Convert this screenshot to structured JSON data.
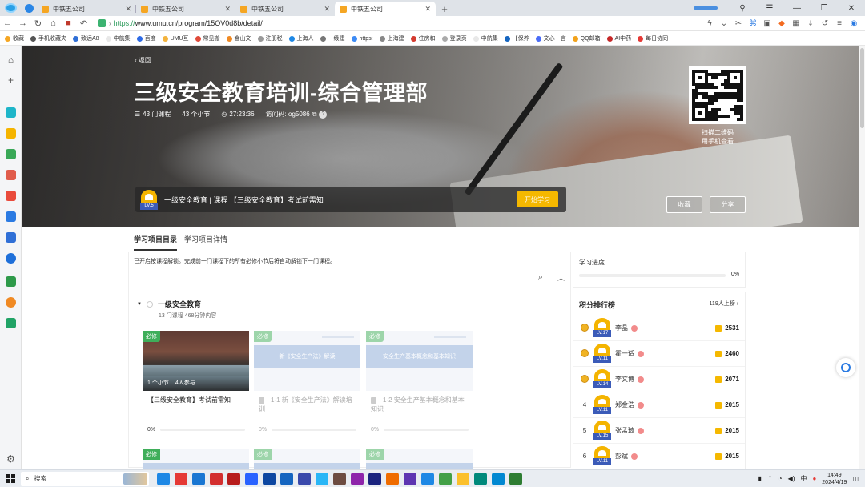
{
  "browser": {
    "tabs": [
      {
        "label": "中铁五公司",
        "active": false
      },
      {
        "label": "中铁五公司",
        "active": false
      },
      {
        "label": "中铁五公司",
        "active": false
      },
      {
        "label": "中铁五公司",
        "active": true
      }
    ],
    "url_protocol": "https://",
    "url_rest": "www.umu.cn/program/15OV0d8b/detail/",
    "bookmarks": [
      "收藏",
      "手机收藏夹",
      "致远A8",
      "中航集",
      "百度",
      "UMU互",
      "常见搬",
      "金山文",
      "注册税",
      "上海人",
      "一级建",
      "https:",
      "上海建",
      "住房和",
      "登录页",
      "中航集",
      "【保养",
      "文心一言",
      "QQ邮箱",
      "AI中药",
      "每日协同"
    ]
  },
  "hero": {
    "back_label": "返回",
    "title": "三级安全教育培训-综合管理部",
    "courses": "43 门课程",
    "sections": "43 个小节",
    "duration": "27:23:36",
    "access_code": "访问码: og5086",
    "qr_caption_1": "扫描二维码",
    "qr_caption_2": "用手机查看",
    "level": "LV.5",
    "current_item": "一级安全教育 | 课程 【三级安全教育】考试前需知",
    "start_btn": "开始学习",
    "favorite_btn": "收藏",
    "share_btn": "分享"
  },
  "main": {
    "tabs": [
      "学习项目目录",
      "学习项目详情"
    ],
    "notice": "已开启按课程解锁。完成前一门课程下的所有必修小节后将自动解锁下一门课程。",
    "section": {
      "name": "一级安全教育",
      "sub": "13 门课程   468分钟内容"
    },
    "cards": [
      {
        "badge": "必修",
        "title": "【三级安全教育】考试前需知",
        "sections": "1 个小节",
        "learners": "4人参与",
        "progress": "0%",
        "band": ""
      },
      {
        "badge": "必修",
        "title": "1-1 新《安全生产法》解读培训",
        "progress": "0%",
        "band": "新《安全生产法》解读"
      },
      {
        "badge": "必修",
        "title": "1-2 安全生产基本概念和基本知识",
        "progress": "0%",
        "band": "安全生产基本概念和基本知识"
      }
    ],
    "second_row_badges": [
      "必修",
      "必修",
      "必修"
    ]
  },
  "progress_panel": {
    "label": "学习进度",
    "value": "0%"
  },
  "ranking": {
    "title": "积分排行榜",
    "more": "119人上榜",
    "rows": [
      {
        "rank": "",
        "level": "LV.17",
        "name": "李晶",
        "score": "2531"
      },
      {
        "rank": "",
        "level": "LV.11",
        "name": "霍一适",
        "score": "2460"
      },
      {
        "rank": "",
        "level": "LV.14",
        "name": "李文博",
        "score": "2071"
      },
      {
        "rank": "4",
        "level": "LV.11",
        "name": "郑金浩",
        "score": "2015"
      },
      {
        "rank": "5",
        "level": "LV.15",
        "name": "张孟琦",
        "score": "2015"
      },
      {
        "rank": "6",
        "level": "LV.11",
        "name": "彭斌",
        "score": "2015"
      }
    ]
  },
  "taskbar": {
    "search": "搜索",
    "ime": "中",
    "time": "14:49",
    "date": "2024/4/19",
    "app_colors": [
      "#1e88e5",
      "#e53935",
      "#1976d2",
      "#d32f2f",
      "#b71c1c",
      "#2962ff",
      "#0d47a1",
      "#1565c0",
      "#3949ab",
      "#29b6f6",
      "#6d4c41",
      "#8e24aa",
      "#1a237e",
      "#ef6c00",
      "#5e35b1",
      "#1e88e5",
      "#43a047",
      "#fbc02d",
      "#00897b",
      "#0288d1",
      "#2e7d32"
    ]
  }
}
